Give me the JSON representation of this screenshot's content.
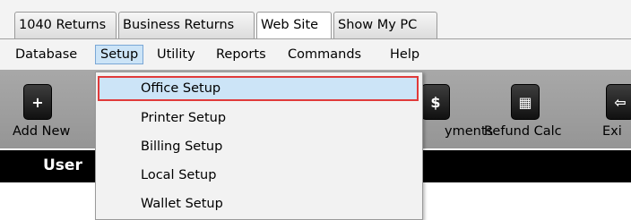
{
  "tabs": [
    {
      "label": "1040 Returns"
    },
    {
      "label": "Business Returns"
    },
    {
      "label": "Web Site"
    },
    {
      "label": "Show My PC"
    }
  ],
  "menu": {
    "database": "Database",
    "setup": "Setup",
    "utility": "Utility",
    "reports": "Reports",
    "commands": "Commands",
    "help": "Help"
  },
  "toolbar": {
    "add_new": "Add New",
    "payments": "yments",
    "refund_calc": "Refund Calc",
    "exit": "Exi"
  },
  "band": {
    "text": "User"
  },
  "dropdown": {
    "items": [
      {
        "label": "Office Setup"
      },
      {
        "label": "Printer Setup"
      },
      {
        "label": "Billing Setup"
      },
      {
        "label": "Local Setup"
      },
      {
        "label": "Wallet Setup"
      }
    ]
  },
  "colors": {
    "highlight": "#cce4f7",
    "selection_border": "#e03a3a",
    "toolbar": "#a0a0a0",
    "band": "#000000"
  }
}
